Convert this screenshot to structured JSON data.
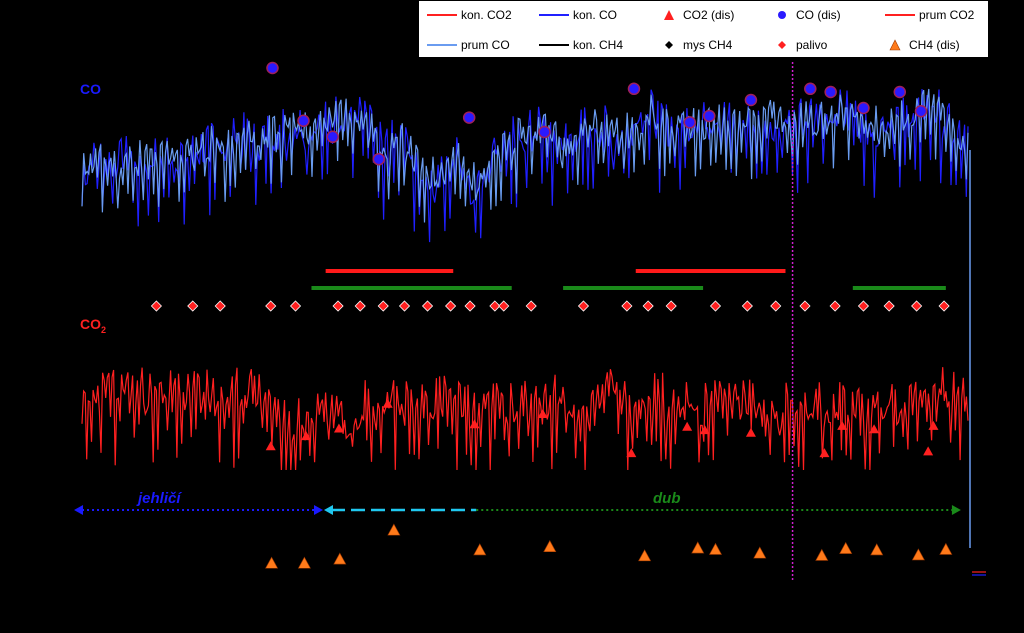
{
  "colors": {
    "kon_co2": "#ff2020",
    "kon_co": "#2020ff",
    "prum_co": "#6a9cf0",
    "prum_co2": "#ff2020",
    "kon_ch4": "#000000",
    "co_dis": "#2a1aff",
    "co_dis_edge": "#a0205a",
    "ch4_dis": "#ff7a1a",
    "palivo": "#ff2020",
    "bar_red": "#ff1a1a",
    "bar_green": "#1a8a1a",
    "vline": "#d020d0",
    "jehlici": "#1a1aff",
    "transition": "#20c8f0",
    "dub": "#1a8a1a"
  },
  "legend": {
    "kon_co2": "kon. CO2",
    "kon_co": "kon. CO",
    "co2_dis": "CO2 (dis)",
    "co_dis": "CO (dis)",
    "prum_co2": "prum CO2",
    "prum_co": "prum CO",
    "kon_ch4": "kon. CH4",
    "mys_ch4": "mys CH4",
    "palivo": "palivo",
    "ch4_dis": "CH4 (dis)"
  },
  "labels": {
    "co": "CO",
    "co2": "CO",
    "co2_sub": "2",
    "jehlici": "jehličí",
    "dub": "dub"
  },
  "chart_data": {
    "type": "line",
    "x_range": [
      0,
      100
    ],
    "series": [
      {
        "name": "prum CO",
        "key": "co",
        "y_range": [
          0,
          100
        ],
        "points": [
          [
            0,
            45
          ],
          [
            2,
            52
          ],
          [
            4,
            48
          ],
          [
            6,
            55
          ],
          [
            8,
            50
          ],
          [
            10,
            57
          ],
          [
            12,
            53
          ],
          [
            14,
            60
          ],
          [
            16,
            58
          ],
          [
            18,
            64
          ],
          [
            20,
            62
          ],
          [
            22,
            68
          ],
          [
            24,
            72
          ],
          [
            26,
            66
          ],
          [
            28,
            73
          ],
          [
            30,
            80
          ],
          [
            32,
            72
          ],
          [
            34,
            58
          ],
          [
            36,
            62
          ],
          [
            38,
            48
          ],
          [
            40,
            42
          ],
          [
            42,
            55
          ],
          [
            44,
            38
          ],
          [
            46,
            50
          ],
          [
            48,
            62
          ],
          [
            50,
            64
          ],
          [
            52,
            70
          ],
          [
            54,
            60
          ],
          [
            56,
            66
          ],
          [
            58,
            72
          ],
          [
            60,
            64
          ],
          [
            62,
            68
          ],
          [
            64,
            78
          ],
          [
            66,
            70
          ],
          [
            68,
            74
          ],
          [
            70,
            70
          ],
          [
            72,
            76
          ],
          [
            74,
            68
          ],
          [
            76,
            72
          ],
          [
            78,
            74
          ],
          [
            80,
            70
          ],
          [
            82,
            75
          ],
          [
            84,
            72
          ],
          [
            86,
            78
          ],
          [
            88,
            72
          ],
          [
            90,
            70
          ],
          [
            92,
            74
          ],
          [
            94,
            76
          ],
          [
            96,
            84
          ],
          [
            98,
            68
          ],
          [
            100,
            60
          ]
        ]
      },
      {
        "name": "kon. CO2",
        "key": "co2",
        "y_range": [
          0,
          100
        ],
        "points": [
          [
            0,
            40
          ],
          [
            2,
            58
          ],
          [
            4,
            56
          ],
          [
            6,
            60
          ],
          [
            8,
            54
          ],
          [
            10,
            58
          ],
          [
            12,
            52
          ],
          [
            14,
            62
          ],
          [
            16,
            50
          ],
          [
            18,
            60
          ],
          [
            20,
            56
          ],
          [
            22,
            44
          ],
          [
            24,
            36
          ],
          [
            26,
            40
          ],
          [
            28,
            48
          ],
          [
            30,
            38
          ],
          [
            32,
            52
          ],
          [
            34,
            46
          ],
          [
            36,
            54
          ],
          [
            38,
            48
          ],
          [
            40,
            56
          ],
          [
            42,
            50
          ],
          [
            44,
            46
          ],
          [
            46,
            52
          ],
          [
            48,
            44
          ],
          [
            50,
            54
          ],
          [
            52,
            48
          ],
          [
            54,
            56
          ],
          [
            56,
            50
          ],
          [
            58,
            48
          ],
          [
            60,
            58
          ],
          [
            62,
            46
          ],
          [
            64,
            54
          ],
          [
            66,
            52
          ],
          [
            68,
            48
          ],
          [
            70,
            46
          ],
          [
            72,
            50
          ],
          [
            74,
            54
          ],
          [
            76,
            46
          ],
          [
            78,
            42
          ],
          [
            80,
            48
          ],
          [
            82,
            52
          ],
          [
            84,
            46
          ],
          [
            86,
            50
          ],
          [
            88,
            48
          ],
          [
            90,
            52
          ],
          [
            92,
            46
          ],
          [
            94,
            50
          ],
          [
            96,
            58
          ],
          [
            98,
            56
          ],
          [
            100,
            48
          ]
        ]
      }
    ],
    "co_dis_points": [
      [
        21.5,
        95
      ],
      [
        25,
        62
      ],
      [
        28.3,
        52
      ],
      [
        33.5,
        38
      ],
      [
        43.7,
        64
      ],
      [
        52.2,
        55
      ],
      [
        62.3,
        82
      ],
      [
        68.6,
        61
      ],
      [
        70.8,
        65
      ],
      [
        75.5,
        75
      ],
      [
        82.2,
        82
      ],
      [
        84.5,
        80
      ],
      [
        88.2,
        70
      ],
      [
        92.3,
        80
      ],
      [
        94.7,
        68
      ]
    ],
    "co2_dis_points": [
      [
        21.3,
        22
      ],
      [
        25.3,
        34
      ],
      [
        29,
        43
      ],
      [
        34.5,
        72
      ],
      [
        44.3,
        48
      ],
      [
        52,
        60
      ],
      [
        62,
        14
      ],
      [
        68.3,
        45
      ],
      [
        70.3,
        41
      ],
      [
        75.5,
        38
      ],
      [
        83.8,
        14
      ],
      [
        85.8,
        46
      ],
      [
        89.4,
        42
      ],
      [
        95.5,
        16
      ],
      [
        96.1,
        46
      ]
    ],
    "ch4_dis_points": [
      [
        21.4,
        6
      ],
      [
        25.1,
        6
      ],
      [
        29.1,
        15
      ],
      [
        35.2,
        78
      ],
      [
        44.9,
        35
      ],
      [
        52.8,
        42
      ],
      [
        63.5,
        22
      ],
      [
        69.5,
        39
      ],
      [
        71.5,
        36
      ],
      [
        76.5,
        28
      ],
      [
        83.5,
        23
      ],
      [
        86.2,
        38
      ],
      [
        89.7,
        35
      ],
      [
        94.4,
        24
      ],
      [
        97.5,
        36
      ]
    ],
    "palivo_x": [
      8.4,
      12.5,
      15.6,
      21.3,
      24.1,
      28.9,
      31.4,
      34,
      36.4,
      39,
      41.6,
      43.8,
      46.6,
      47.6,
      50.7,
      56.6,
      61.5,
      63.9,
      66.5,
      71.5,
      75.1,
      78.3,
      81.6,
      85,
      88.2,
      91.1,
      94.2,
      97.3
    ],
    "red_bars": [
      [
        27.5,
        41.9
      ],
      [
        62.5,
        79.4
      ]
    ],
    "green_bars": [
      [
        25.9,
        48.5
      ],
      [
        54.3,
        70.1
      ],
      [
        87,
        97.5
      ]
    ],
    "vline_x": 80.2,
    "co_axis_label": "CO",
    "co2_axis_label": "CO2"
  }
}
